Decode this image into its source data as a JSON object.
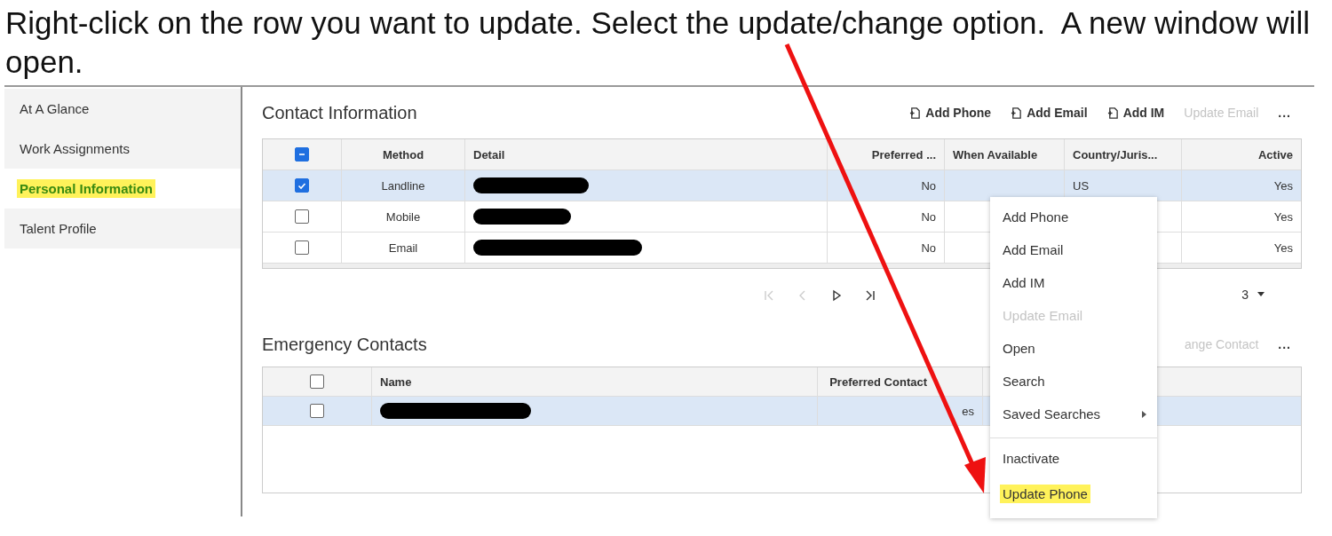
{
  "instruction": "Right-click on the row you want to update. Select the update/change option.  A new window will open.",
  "sidebar": {
    "items": [
      {
        "label": "At A Glance",
        "selected": false,
        "highlighted": false
      },
      {
        "label": "Work Assignments",
        "selected": false,
        "highlighted": false
      },
      {
        "label": "Personal Information",
        "selected": true,
        "highlighted": true
      },
      {
        "label": "Talent Profile",
        "selected": false,
        "highlighted": false
      }
    ]
  },
  "contact_information": {
    "title": "Contact Information",
    "toolbar": [
      {
        "label": "Add Phone",
        "kind": "icon",
        "disabled": false
      },
      {
        "label": "Add Email",
        "kind": "icon",
        "disabled": false
      },
      {
        "label": "Add IM",
        "kind": "icon",
        "disabled": false
      },
      {
        "label": "Update Email",
        "kind": "text",
        "disabled": true
      },
      {
        "label": "...",
        "kind": "more",
        "disabled": false
      }
    ],
    "table": {
      "header_checkbox": {
        "indeterminate": true
      },
      "columns": [
        {
          "label": "Method"
        },
        {
          "label": "Detail"
        },
        {
          "label": "Preferred ..."
        },
        {
          "label": "When Available"
        },
        {
          "label": "Country/Juris..."
        },
        {
          "label": "Active"
        }
      ],
      "rows": [
        {
          "selected": true,
          "checked": true,
          "method": "Landline",
          "redacted": true,
          "preferred": "No",
          "country": "US",
          "active": "Yes"
        },
        {
          "selected": false,
          "checked": false,
          "method": "Mobile",
          "redacted": true,
          "preferred": "No",
          "active": "Yes"
        },
        {
          "selected": false,
          "checked": false,
          "method": "Email",
          "redacted": true,
          "preferred": "No",
          "active": "Yes"
        }
      ]
    },
    "pager": {
      "buttons": [
        {
          "kind": "first",
          "disabled": true
        },
        {
          "kind": "prev",
          "disabled": true
        },
        {
          "kind": "next",
          "disabled": false
        },
        {
          "kind": "last",
          "disabled": false
        }
      ],
      "page_size": "3"
    }
  },
  "emergency_contacts": {
    "title": "Emergency Contacts",
    "toolbar": [
      {
        "label": "ange Contact",
        "kind": "text",
        "disabled": true
      },
      {
        "label": "...",
        "kind": "more",
        "disabled": false
      }
    ],
    "table": {
      "header_checkbox": {
        "checked": false
      },
      "columns": [
        {
          "label": "Name"
        },
        {
          "label": "Preferred Contact"
        }
      ],
      "rows": [
        {
          "selected": true,
          "checked": false,
          "redacted": true,
          "preferred_contact": "es"
        }
      ]
    }
  },
  "context_menu": {
    "items": [
      {
        "label": "Add Phone",
        "disabled": false,
        "submenu": false,
        "highlighted": false,
        "separator_before": false
      },
      {
        "label": "Add Email",
        "disabled": false,
        "submenu": false,
        "highlighted": false,
        "separator_before": false
      },
      {
        "label": "Add IM",
        "disabled": false,
        "submenu": false,
        "highlighted": false,
        "separator_before": false
      },
      {
        "label": "Update Email",
        "disabled": true,
        "submenu": false,
        "highlighted": false,
        "separator_before": false
      },
      {
        "label": "Open",
        "disabled": false,
        "submenu": false,
        "highlighted": false,
        "separator_before": false
      },
      {
        "label": "Search",
        "disabled": false,
        "submenu": false,
        "highlighted": false,
        "separator_before": false
      },
      {
        "label": "Saved Searches",
        "disabled": false,
        "submenu": true,
        "highlighted": false,
        "separator_before": false
      },
      {
        "label": "Inactivate",
        "disabled": false,
        "submenu": false,
        "highlighted": false,
        "separator_before": true
      },
      {
        "label": "Update Phone",
        "disabled": false,
        "submenu": false,
        "highlighted": true,
        "separator_before": false
      }
    ]
  }
}
